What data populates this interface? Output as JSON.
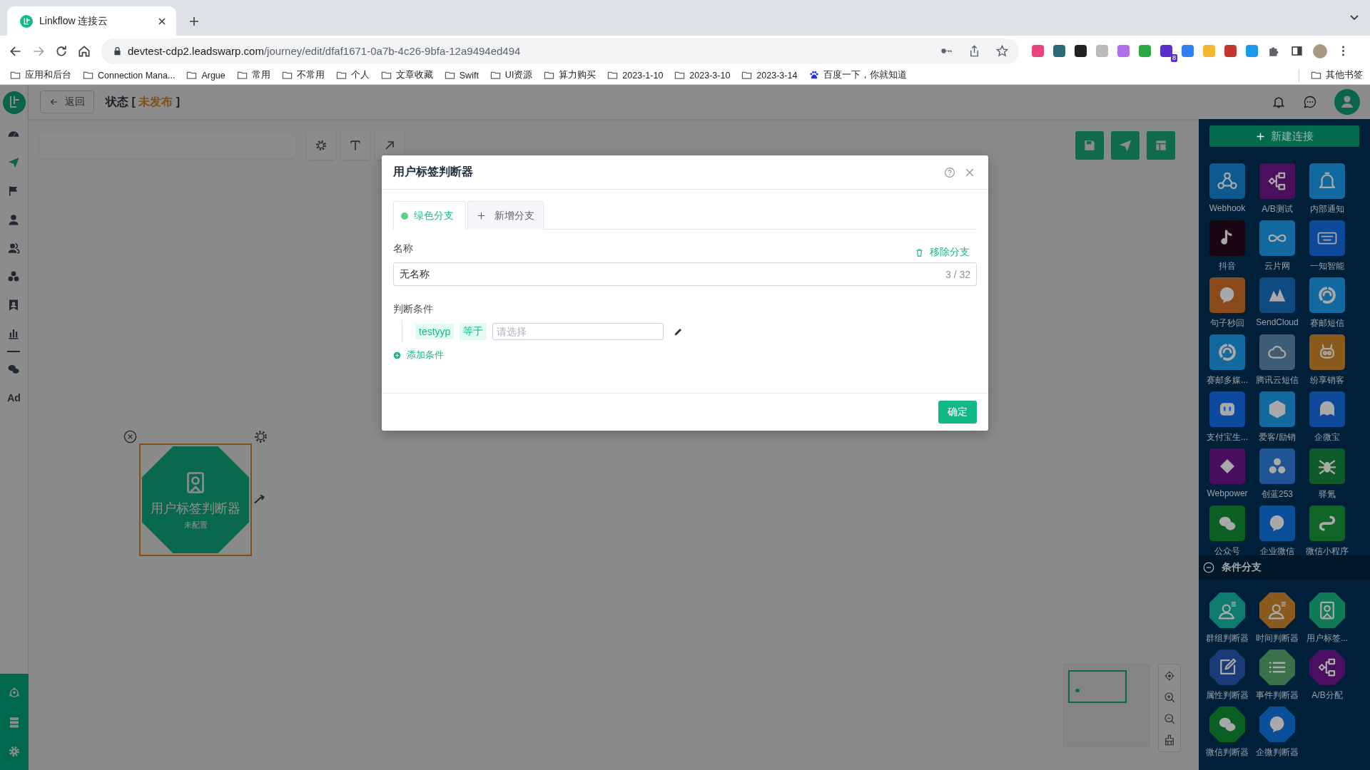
{
  "browser": {
    "tab_title": "Linkflow 连接云",
    "url_host": "devtest-cdp2.leadswarp.com",
    "url_path": "/journey/edit/dfaf1671-0a7b-4c26-9bfa-12a9494ed494",
    "extension_badge": "8",
    "bookmarks": [
      {
        "label": "应用和后台",
        "kind": "folder"
      },
      {
        "label": "Connection Mana...",
        "kind": "folder"
      },
      {
        "label": "Argue",
        "kind": "folder"
      },
      {
        "label": "常用",
        "kind": "folder"
      },
      {
        "label": "不常用",
        "kind": "folder"
      },
      {
        "label": "个人",
        "kind": "folder"
      },
      {
        "label": "文章收藏",
        "kind": "folder"
      },
      {
        "label": "Swift",
        "kind": "folder"
      },
      {
        "label": "UI资源",
        "kind": "folder"
      },
      {
        "label": "算力购买",
        "kind": "folder"
      },
      {
        "label": "2023-1-10",
        "kind": "folder"
      },
      {
        "label": "2023-3-10",
        "kind": "folder"
      },
      {
        "label": "2023-3-14",
        "kind": "folder"
      },
      {
        "label": "百度一下，你就知道",
        "kind": "site"
      }
    ],
    "other_bookmarks": "其他书签"
  },
  "sidebar": {
    "items": [
      {
        "selected": false
      },
      {
        "selected": true
      },
      {
        "selected": false
      },
      {
        "selected": false
      },
      {
        "selected": false
      },
      {
        "selected": false
      },
      {
        "selected": false
      },
      {
        "selected": false
      },
      {
        "selected": false
      },
      {
        "selected": false,
        "label": "Ad"
      }
    ]
  },
  "header": {
    "back": "返回",
    "status_label": "状态 [",
    "status_value": "未发布",
    "status_close": "]"
  },
  "canvas": {
    "node": {
      "title": "用户标签判断器",
      "subtitle": "未配置",
      "selected": true
    }
  },
  "panel": {
    "new_button": "新建连接",
    "connectors": [
      {
        "label": "Webhook",
        "color": "#0e5a90"
      },
      {
        "label": "A/B测试",
        "color": "#4c0f5c"
      },
      {
        "label": "内部通知",
        "color": "#11699f"
      },
      {
        "label": "抖音",
        "color": "#1a0612"
      },
      {
        "label": "云片网",
        "color": "#11699f"
      },
      {
        "label": "一知智能",
        "color": "#0f4a9a"
      },
      {
        "label": "句子秒回",
        "color": "#8a4a1a"
      },
      {
        "label": "SendCloud",
        "color": "#0f4a80"
      },
      {
        "label": "赛邮短信",
        "color": "#11699f"
      },
      {
        "label": "赛邮多媒...",
        "color": "#11699f"
      },
      {
        "label": "腾讯云短信",
        "color": "#3e5d75"
      },
      {
        "label": "纷享销客",
        "color": "#8a5a1a"
      },
      {
        "label": "支付宝生...",
        "color": "#0c4aa0"
      },
      {
        "label": "爱客/励销",
        "color": "#11699f"
      },
      {
        "label": "企微宝",
        "color": "#0f4a9a"
      },
      {
        "label": "Webpower",
        "color": "#4a0e60"
      },
      {
        "label": "创蓝253",
        "color": "#1f5593"
      },
      {
        "label": "驿氪",
        "color": "#0e5a2a"
      },
      {
        "label": "公众号",
        "color": "#0a6020"
      },
      {
        "label": "企业微信",
        "color": "#0a4f99"
      },
      {
        "label": "微信小程序",
        "color": "#0e6526"
      }
    ],
    "section": {
      "title": "条件分支",
      "expanded": true
    },
    "conditions": [
      {
        "label": "群组判断器",
        "color": "#0f7a70"
      },
      {
        "label": "时间判断器",
        "color": "#8a5a1e"
      },
      {
        "label": "用户标签...",
        "color": "#0e7a58"
      },
      {
        "label": "属性判断器",
        "color": "#1a3a78"
      },
      {
        "label": "事件判断器",
        "color": "#3a704a"
      },
      {
        "label": "A/B分配",
        "color": "#4a0f60"
      },
      {
        "label": "微信判断器",
        "color": "#0a6020"
      },
      {
        "label": "企微判断器",
        "color": "#0a4f99"
      }
    ]
  },
  "modal": {
    "title": "用户标签判断器",
    "tabs": [
      {
        "label": "绿色分支",
        "kind": "branch",
        "selected": true,
        "color": "#5ad08a"
      },
      {
        "label": "新增分支",
        "kind": "add",
        "selected": false
      }
    ],
    "name_label": "名称",
    "remove_button": "移除分支",
    "name_value": "无名称",
    "counter": "3 / 32",
    "condition_label": "判断条件",
    "conditions": [
      {
        "field": "testyyp",
        "operator": "等于",
        "placeholder": "请选择"
      }
    ],
    "add_condition": "添加条件",
    "confirm": "确定"
  }
}
